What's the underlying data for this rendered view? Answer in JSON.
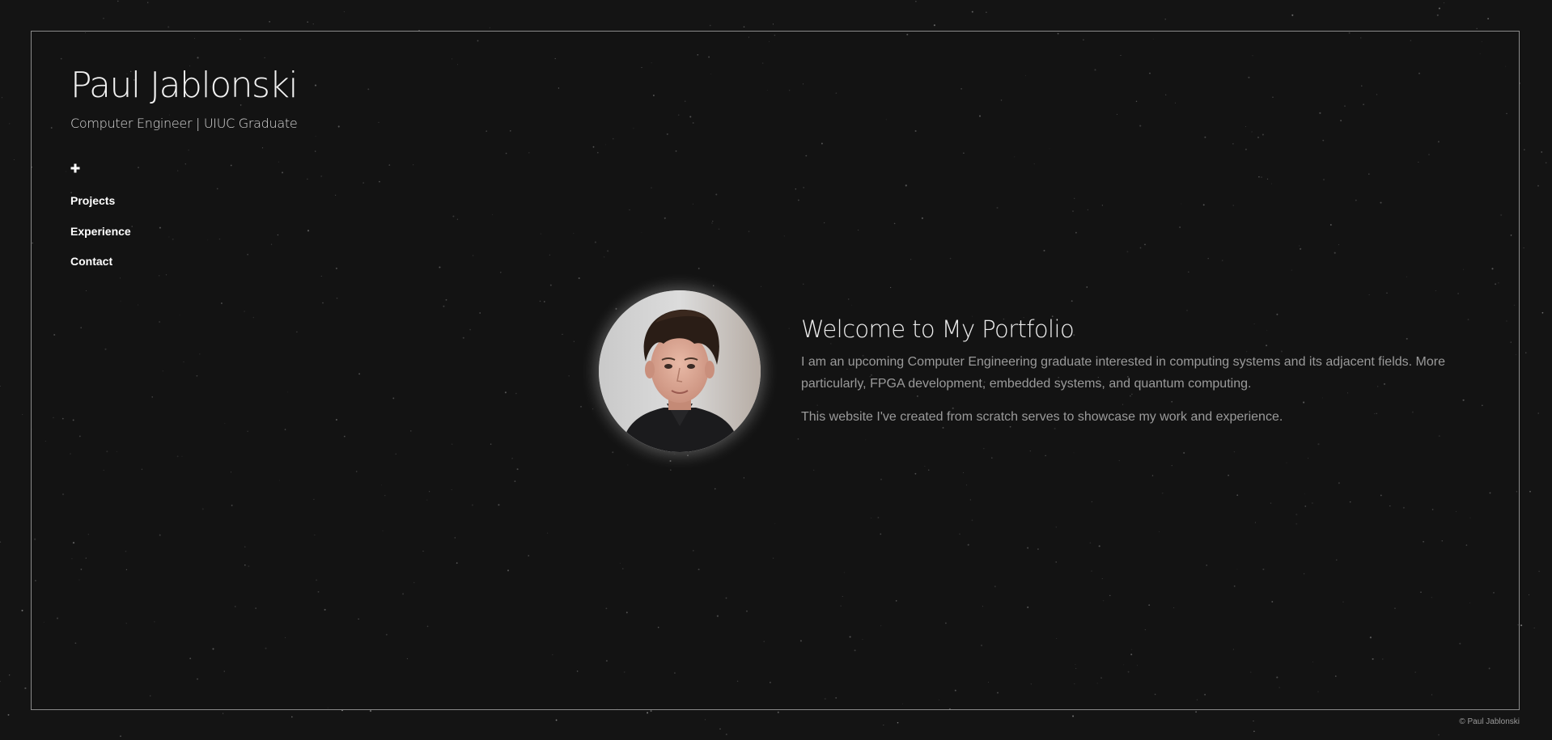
{
  "header": {
    "title": "Paul Jablonski",
    "subtitle": "Computer Engineer | UIUC Graduate"
  },
  "nav": {
    "toggle_icon": "plus-icon",
    "items": [
      {
        "label": "Projects"
      },
      {
        "label": "Experience"
      },
      {
        "label": "Contact"
      }
    ]
  },
  "main": {
    "avatar_icon": "profile-photo",
    "heading": "Welcome to My Portfolio",
    "paragraphs": [
      "I am an upcoming Computer Engineering graduate interested in computing systems and its adjacent fields. More particularly, FPGA development, embedded systems, and quantum computing.",
      "This website I've created from scratch serves to showcase my work and experience."
    ]
  },
  "footer": {
    "copyright": "© Paul Jablonski"
  },
  "colors": {
    "background": "#141414",
    "frame_border": "#8a8a8a",
    "title_text": "#f2f2f2",
    "body_text": "#9a9a9a",
    "nav_text": "#ffffff"
  }
}
